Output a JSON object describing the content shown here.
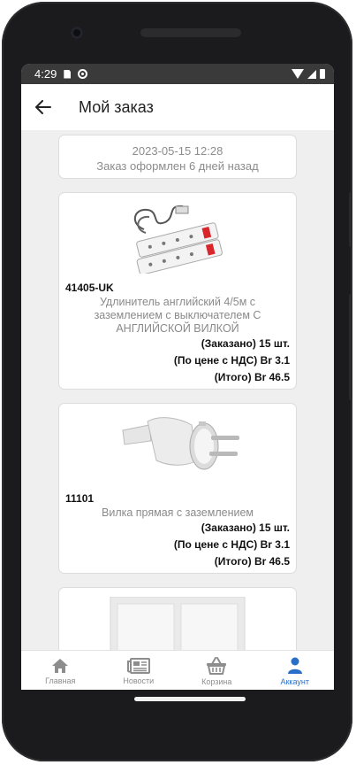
{
  "status_bar": {
    "time": "4:29"
  },
  "header": {
    "title": "Мой заказ"
  },
  "order": {
    "date": "2023-05-15 12:28",
    "placed_text": "Заказ оформлен 6 дней назад"
  },
  "items": [
    {
      "sku": "41405-UK",
      "name": "Удлинитель английский 4/5м с заземлением с выключателем С АНГЛИЙСКОЙ ВИЛКОЙ",
      "ordered": "(Заказано) 15 шт.",
      "unit_price": "(По цене с НДС) Br 3.1",
      "total": "(Итого) Br 46.5"
    },
    {
      "sku": "11101",
      "name": "Вилка прямая с заземлением",
      "ordered": "(Заказано) 15 шт.",
      "unit_price": "(По цене с НДС) Br 3.1",
      "total": "(Итого) Br 46.5"
    }
  ],
  "nav": {
    "home": "Главная",
    "news": "Новости",
    "cart": "Корзина",
    "account": "Аккаунт"
  },
  "colors": {
    "accent": "#2a6fc7",
    "status_bar": "#3a3a3a",
    "background": "#efefef"
  }
}
